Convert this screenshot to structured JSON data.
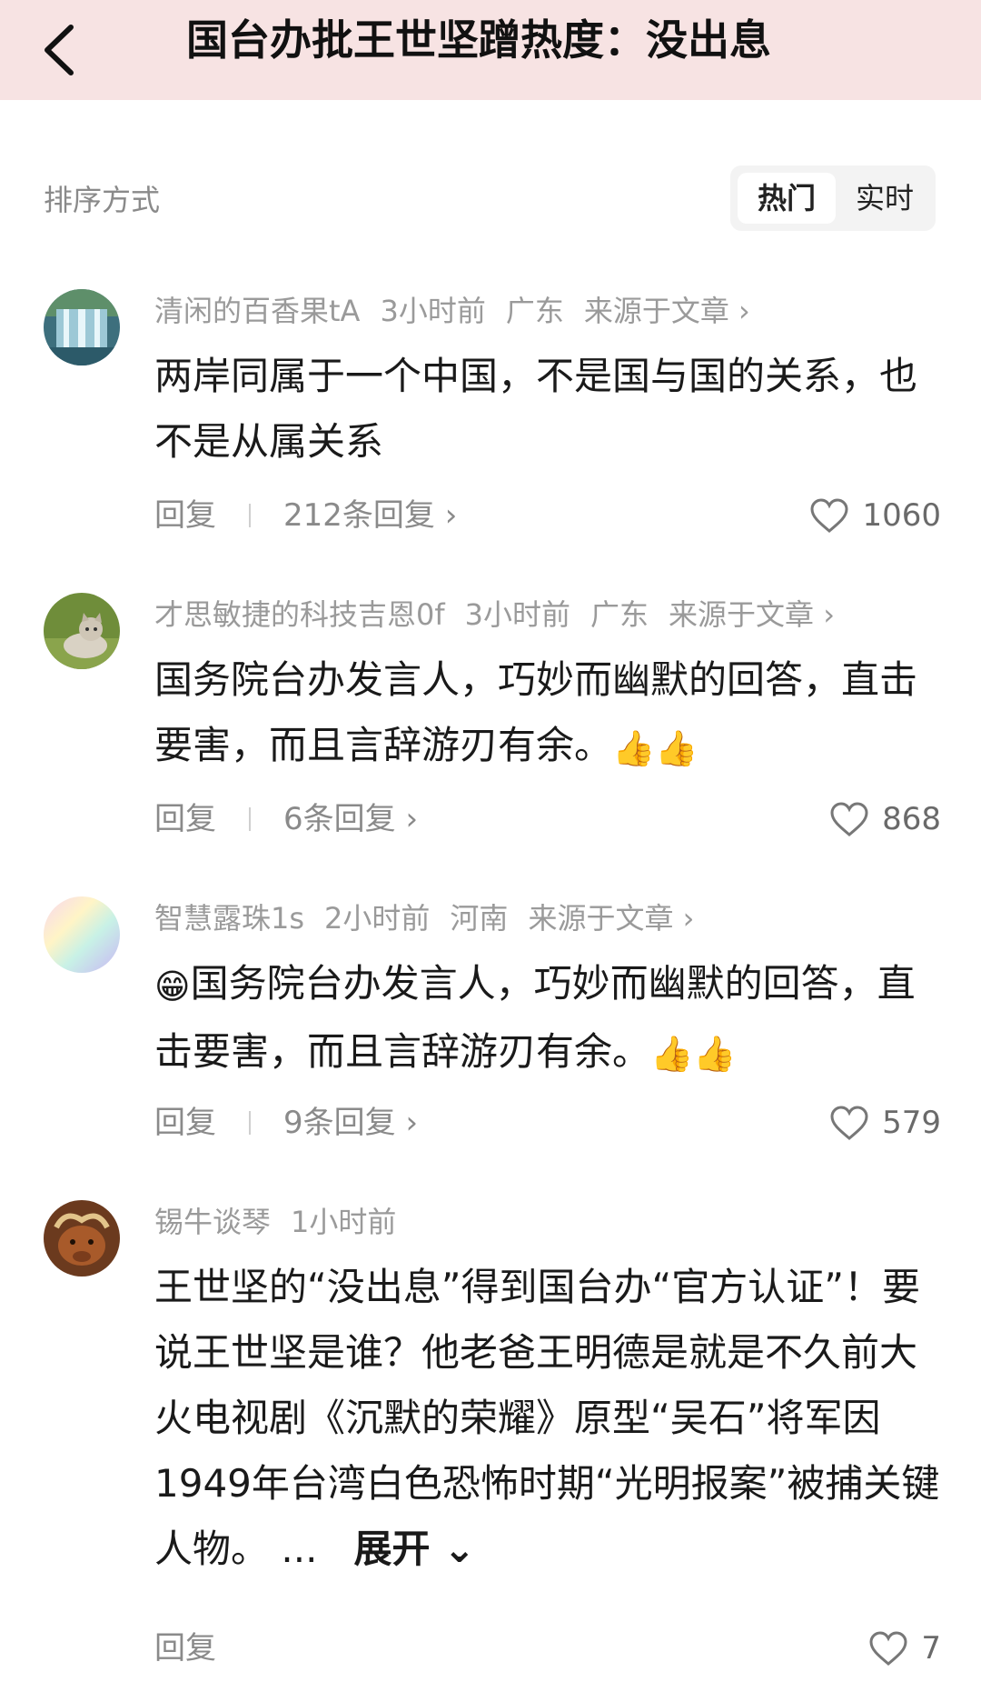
{
  "header": {
    "title": "国台办批王世坚蹭热度：没出息",
    "back_icon": "chevron-left-icon"
  },
  "sort": {
    "label": "排序方式",
    "options": [
      "热门",
      "实时"
    ],
    "selected": "热门"
  },
  "comments": [
    {
      "user": "清闲的百香果tA",
      "time": "3小时前",
      "location": "广东",
      "source": "来源于文章",
      "text": "两岸同属于一个中国，不是国与国的关系，也不是从属关系",
      "reply_label": "回复",
      "replies": "212条回复",
      "likes": "1060",
      "avatar": "waterfall-avatar"
    },
    {
      "user": "才思敏捷的科技吉恩0f",
      "time": "3小时前",
      "location": "广东",
      "source": "来源于文章",
      "text": "国务院台办发言人，巧妙而幽默的回答，直击要害，而且言辞游刃有余。",
      "emoji": "👍👍",
      "reply_label": "回复",
      "replies": "6条回复",
      "likes": "868",
      "avatar": "cat-avatar"
    },
    {
      "user": "智慧露珠1s",
      "time": "2小时前",
      "location": "河南",
      "source": "来源于文章",
      "lead_emoji": "😁",
      "text": "国务院台办发言人，巧妙而幽默的回答，直击要害，而且言辞游刃有余。",
      "emoji": "👍👍",
      "reply_label": "回复",
      "replies": "9条回复",
      "likes": "579",
      "avatar": "gradient-avatar"
    },
    {
      "user": "锡牛谈琴",
      "time": "1小时前",
      "text": "王世坚的“没出息”得到国台办“官方认证”！要说王世坚是谁？他老爸王明德是就是不久前大火电视剧《沉默的荣耀》原型“吴石”将军因1949年台湾白色恐怖时期“光明报案”被捕关键人物。",
      "ellipsis": "...",
      "expand_label": "展开",
      "reply_label": "回复",
      "likes": "7",
      "avatar": "ox-avatar"
    }
  ],
  "colors": {
    "header_bg": "#f7e3e3",
    "meta": "#9a9a9a",
    "text": "#1a1a1a"
  }
}
